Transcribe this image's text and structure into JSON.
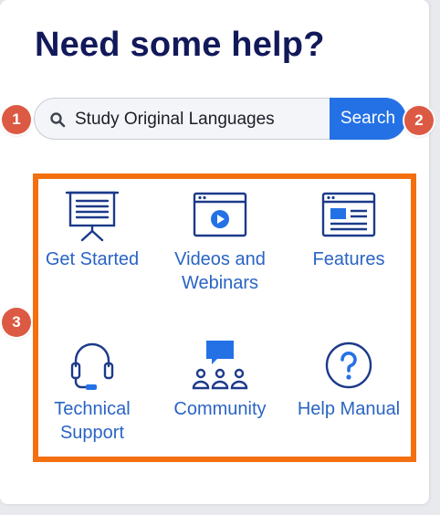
{
  "heading": "Need some help?",
  "search": {
    "value": "Study Original Languages",
    "button_label": "Search"
  },
  "markers": [
    "1",
    "2",
    "3"
  ],
  "tiles": [
    {
      "label_lines": [
        "Get Started"
      ],
      "icon": "presentation-board-icon"
    },
    {
      "label_lines": [
        "Videos and",
        "Webinars"
      ],
      "icon": "video-player-icon"
    },
    {
      "label_lines": [
        "Features"
      ],
      "icon": "browser-window-icon"
    },
    {
      "label_lines": [
        "Technical",
        "Support"
      ],
      "icon": "headset-icon"
    },
    {
      "label_lines": [
        "Community"
      ],
      "icon": "community-chat-icon"
    },
    {
      "label_lines": [
        "Help Manual"
      ],
      "icon": "question-circle-icon"
    }
  ],
  "colors": {
    "heading": "#12195a",
    "accent_blue": "#2471e6",
    "tile_blue": "#2a64c4",
    "icon_navy": "#1c3a8a",
    "annotation_orange": "#f36f10",
    "marker_red": "#dc5a44"
  }
}
